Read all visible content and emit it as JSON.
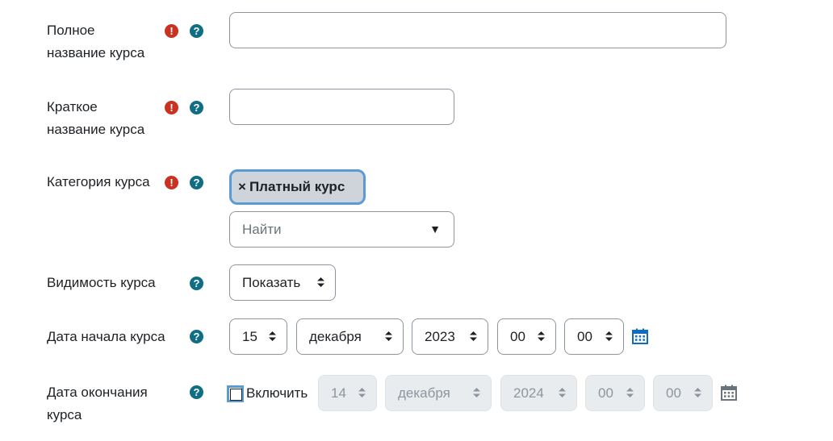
{
  "fields": {
    "fullname": {
      "label_line1": "Полное",
      "label_line2": "название курса",
      "value": ""
    },
    "shortname": {
      "label_line1": "Краткое",
      "label_line2": "название курса",
      "value": ""
    },
    "category": {
      "label": "Категория курса",
      "chip_x": "×",
      "chip_label": "Платный курс",
      "search_placeholder": "Найти",
      "dropdown_arrow": "▼"
    },
    "visibility": {
      "label": "Видимость курса",
      "value": "Показать"
    },
    "startdate": {
      "label": "Дата начала курса",
      "day": "15",
      "month": "декабря",
      "year": "2023",
      "hour": "00",
      "minute": "00"
    },
    "enddate": {
      "label_line1": "Дата окончания",
      "label_line2": "курса",
      "enable_label": "Включить",
      "enabled": false,
      "day": "14",
      "month": "декабря",
      "year": "2024",
      "hour": "00",
      "minute": "00"
    }
  },
  "icons": {
    "required": "!",
    "help": "?"
  },
  "colors": {
    "required": "#ca3120",
    "help": "#0f6e84",
    "focus": "#5b9bd5",
    "chip_bg": "#ced4da"
  }
}
